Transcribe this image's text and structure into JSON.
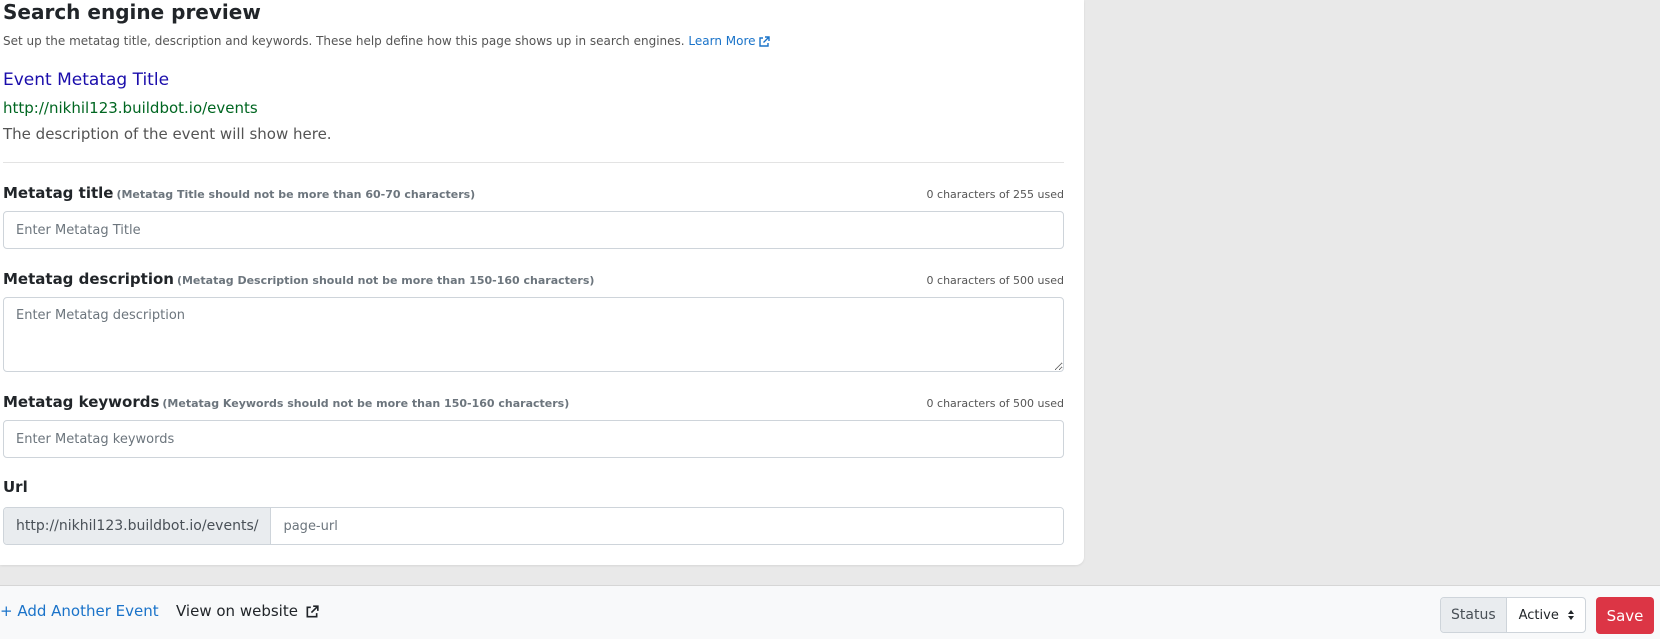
{
  "seo": {
    "title": "Search engine preview",
    "subtitle": "Set up the metatag title, description and keywords. These help define how this page shows up in search engines.",
    "learn_more": "Learn More",
    "preview": {
      "title": "Event Metatag Title",
      "url": "http://nikhil123.buildbot.io/events",
      "description": "The description of the event will show here."
    }
  },
  "fields": {
    "title": {
      "label": "Metatag title",
      "hint": "(Metatag Title should not be more than 60-70 characters)",
      "counter": "0 characters of 255 used",
      "placeholder": "Enter Metatag Title"
    },
    "description": {
      "label": "Metatag description",
      "hint": "(Metatag Description should not be more than 150-160 characters)",
      "counter": "0 characters of 500 used",
      "placeholder": "Enter Metatag description"
    },
    "keywords": {
      "label": "Metatag keywords",
      "hint": "(Metatag Keywords should not be more than 150-160 characters)",
      "counter": "0 characters of 500 used",
      "placeholder": "Enter Metatag keywords"
    },
    "url": {
      "label": "Url",
      "prefix": "http://nikhil123.buildbot.io/events/",
      "placeholder": "page-url"
    }
  },
  "footer": {
    "add_event": "+ Add Another Event",
    "view_site": "View on website",
    "status_label": "Status",
    "status_value": "Active",
    "save_label": "Save"
  },
  "colors": {
    "link": "#1a73c9",
    "preview_title": "#1a0dab",
    "preview_url": "#006621",
    "save": "#dc3545"
  }
}
